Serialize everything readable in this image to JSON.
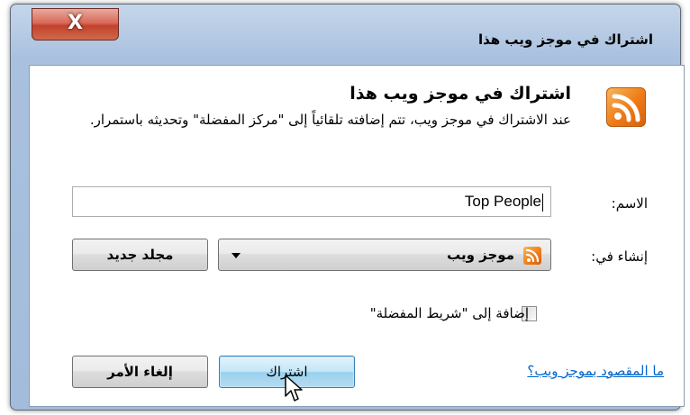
{
  "window": {
    "title": "اشتراك في موجز ويب هذا",
    "close_glyph": "X"
  },
  "header": {
    "heading": "اشتراك في موجز ويب هذا",
    "description": "عند الاشتراك في موجز ويب، تتم إضافته تلقائياً إلى \"مركز المفضلة\" وتحديثه باستمرار.",
    "icon": "rss-feed-icon"
  },
  "form": {
    "name_label": "الاسم:",
    "name_value": "Top People",
    "create_in_label": "إنشاء في:",
    "create_in_value": "موجز ويب",
    "new_folder_label": "مجلد جديد",
    "favorites_bar_label": "إضافة إلى \"شريط المفضلة\"",
    "favorites_bar_checked": false
  },
  "footer": {
    "help_link": "ما المقصود بموجز ويب؟",
    "subscribe_label": "اشتراك",
    "cancel_label": "إلغاء الأمر"
  },
  "colors": {
    "accent": "#ef7a16",
    "link": "#0066cc",
    "frame": "#b3c8e2"
  }
}
